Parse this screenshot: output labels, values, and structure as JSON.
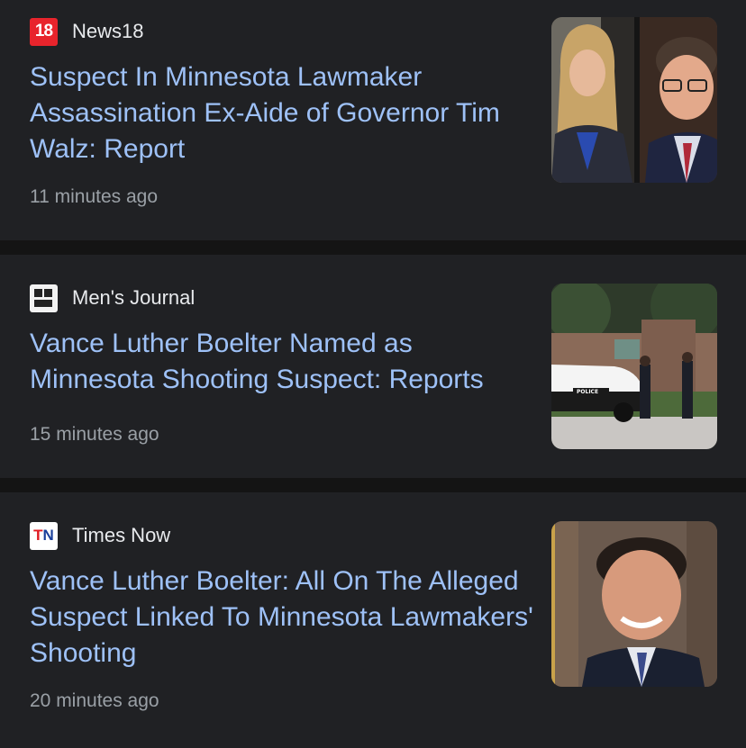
{
  "articles": [
    {
      "source": "News18",
      "logo_text": "18",
      "headline": "Suspect In Minnesota Lawmaker Assassination Ex-Aide of Governor Tim Walz: Report",
      "time": "11 minutes ago"
    },
    {
      "source": "Men's Journal",
      "logo_text": "",
      "headline": "Vance Luther Boelter Named as Minnesota Shooting Suspect: Reports",
      "time": "15 minutes ago",
      "image_text": "POLICE"
    },
    {
      "source": "Times Now",
      "logo_t": "T",
      "logo_n": "N",
      "headline": "Vance Luther Boelter: All On The Alleged Suspect Linked To Minnesota Lawmakers' Shooting",
      "time": "20 minutes ago"
    }
  ],
  "colors": {
    "background": "#202124",
    "separator": "#141414",
    "headline": "#9ec1f7",
    "source": "#e8eaed",
    "time": "#9aa0a6"
  }
}
